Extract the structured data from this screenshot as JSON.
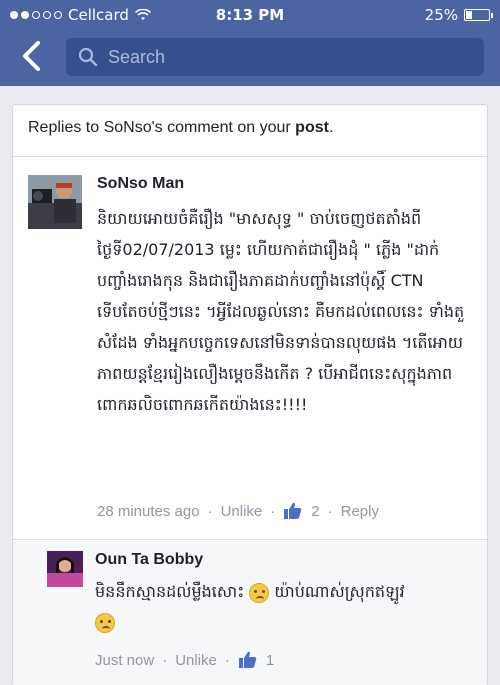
{
  "status_bar": {
    "carrier": "Cellcard",
    "time": "8:13 PM",
    "battery": "25%",
    "battery_level": 0.25
  },
  "nav": {
    "search_placeholder": "Search",
    "icons": [
      "back-arrow-icon",
      "search-icon"
    ]
  },
  "notification": {
    "prefix": "Replies to SoNso's comment on your ",
    "post_word": "post",
    "suffix": "."
  },
  "comment": {
    "author": "SoNso Man",
    "text": "និយាយអោយចំគឺរឿង \"មាសសុទ្ធ \" ចាប់ចេញថតតាំងពីថ្ងៃទី02/07/2013 ម្លេះ ហើយកាត់ជារឿងដុំ \" ភ្លើង \"ដាក់បញ្ចាំងរោងកុន និងជារឿងភាគដាក់បញ្ចាំងនៅប៉ុស្តិ៍ CTN ទើបតែចប់ថ្មីៗនេះ ។អ្វីដែលឆ្ងល់នោះ គឺមកដល់ពេលនេះ ទាំងតួសំដែង ទាំងអ្នកបច្ចេកទេសនៅមិនទាន់បានលុយផង ។តើអោយភាពយន្តខ្មែររៀងលឿងម្តេចនឹងកើត ? បើអាជីពនេះសុក្នុងភាព ពោកឆលិចពោកឆកើតយ៉ាងនេះ!!!!",
    "time": "28 minutes ago",
    "unlike": "Unlike",
    "likes": "2",
    "reply": "Reply"
  },
  "reply": {
    "author": "Oun Ta Bobby",
    "text_part1": "មិននឹកស្មានដល់ម្លឹងសោះ",
    "text_part2": "យ៉ាប់ណាស់ស្រុកឥឡូវ",
    "time": "Just now",
    "unlike": "Unlike",
    "likes": "1"
  },
  "colors": {
    "header": "#4b65a3",
    "search_box": "#35508f",
    "like_blue": "#4b6fc8"
  }
}
